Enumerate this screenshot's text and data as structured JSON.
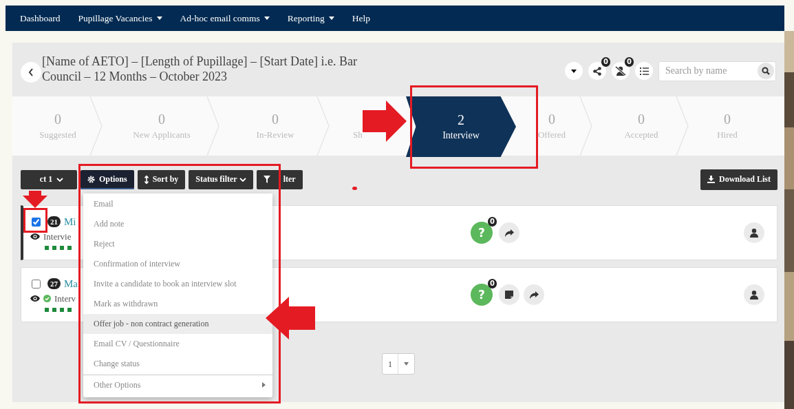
{
  "nav": [
    {
      "label": "Dashboard",
      "dropdown": false
    },
    {
      "label": "Pupillage Vacancies",
      "dropdown": true
    },
    {
      "label": "Ad-hoc email comms",
      "dropdown": true
    },
    {
      "label": "Reporting",
      "dropdown": true
    },
    {
      "label": "Help",
      "dropdown": false
    }
  ],
  "job": {
    "title": "[Name of AETO] – [Length of Pupillage] – [Start Date] i.e. Bar Council – 12 Months – October 2023",
    "shared_count": "0",
    "hidden_count": "0"
  },
  "search": {
    "placeholder": "Search by name"
  },
  "stages": [
    {
      "count": "0",
      "label": "Suggested",
      "selected": false
    },
    {
      "count": "0",
      "label": "New Applicants",
      "selected": false
    },
    {
      "count": "0",
      "label": "In-Review",
      "selected": false
    },
    {
      "label": "Sh",
      "selected": false
    },
    {
      "count": "2",
      "label": "Interview",
      "selected": true
    },
    {
      "count": "0",
      "label": "Offered",
      "selected": false
    },
    {
      "count": "0",
      "label": "Accepted",
      "selected": false
    },
    {
      "count": "0",
      "label": "Hired",
      "selected": false
    }
  ],
  "buttons": [
    {
      "label": "ct 1",
      "kind": "select"
    },
    {
      "label": "Options",
      "kind": "options"
    },
    {
      "label": "Sort by",
      "kind": "sort"
    },
    {
      "label": "Status filter",
      "kind": "status"
    },
    {
      "label": "lter",
      "kind": "filter"
    }
  ],
  "download": {
    "label": "Download List"
  },
  "candidates": [
    {
      "number": "21",
      "name": "Mi",
      "status": "Intervie",
      "checked": true,
      "verified": false,
      "note": false,
      "question": "?",
      "answers_count": "0"
    },
    {
      "number": "27",
      "name": "Ma",
      "status": "Interv",
      "checked": false,
      "verified": true,
      "note": true,
      "question": "?",
      "answers_count": "0"
    }
  ],
  "menu": {
    "open": true,
    "items": [
      {
        "label": "Email",
        "highlighted": false,
        "kind": "item"
      },
      {
        "label": "Add note",
        "highlighted": false,
        "kind": "item"
      },
      {
        "label": "Reject",
        "highlighted": false,
        "kind": "item"
      },
      {
        "label": "Confirmation of interview",
        "highlighted": false,
        "kind": "item"
      },
      {
        "label": "Invite a candidate to book an interview slot",
        "highlighted": false,
        "kind": "item"
      },
      {
        "label": "Mark as withdrawn",
        "highlighted": false,
        "kind": "item"
      },
      {
        "label": "Offer job - non contract generation",
        "highlighted": true,
        "kind": "item"
      },
      {
        "label": "Email CV / Questionnaire",
        "highlighted": false,
        "kind": "item"
      },
      {
        "label": "Change status",
        "highlighted": false,
        "kind": "item"
      },
      {
        "label": "Other Options",
        "highlighted": false,
        "kind": "submenu"
      }
    ]
  },
  "pagination": {
    "page": "1"
  },
  "annotations": [
    {
      "kind": "box"
    },
    {
      "kind": "arrow"
    },
    {
      "kind": "box"
    },
    {
      "kind": "arrow"
    },
    {
      "kind": "box"
    },
    {
      "kind": "arrow"
    },
    {
      "kind": "dot"
    }
  ]
}
